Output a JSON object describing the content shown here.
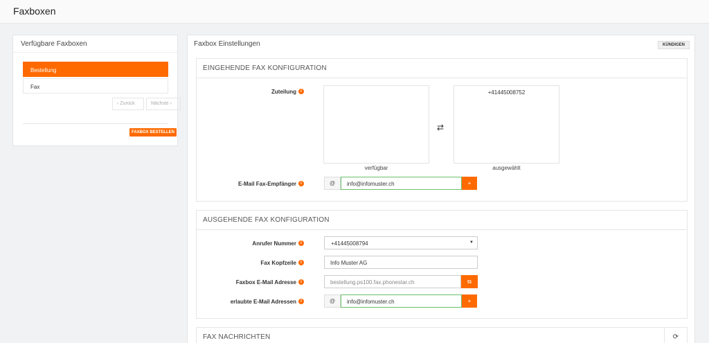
{
  "header": {
    "title": "Faxboxen"
  },
  "left": {
    "title": "Verfügbare Faxboxen",
    "items": [
      {
        "label": "Bestellung"
      },
      {
        "label": "Fax"
      }
    ],
    "prev_label": "‹ Zurück",
    "next_label": "Nächste ›",
    "order_button": "FAXBOX BESTELLEN"
  },
  "right": {
    "title": "Faxbox Einstellungen",
    "cancel_button": "KÜNDIGEN",
    "incoming": {
      "title": "EINGEHENDE FAX KONFIGURATION",
      "assignment_label": "Zuteilung",
      "available_caption": "verfügbar",
      "selected_caption": "ausgewählt",
      "selected_items": [
        "+41445008752"
      ],
      "swap_icon": "⇄",
      "email_label": "E-Mail Fax-Empfänger",
      "email_value": "info@infomuster.ch",
      "at_icon": "@",
      "plus": "+"
    },
    "outgoing": {
      "title": "AUSGEHENDE FAX KONFIGURATION",
      "caller_label": "Anrufer Nummer",
      "caller_value": "+41445008794",
      "header_label": "Fax Kopfzeile",
      "header_value": "Info Muster AG",
      "faxbox_email_label": "Faxbox E-Mail Adresse",
      "faxbox_email_value": "bestellung.ps100.fax.phonestar.ch",
      "allowed_label": "erlaubte E-Mail Adressen",
      "allowed_value": "info@infomuster.ch",
      "at_icon": "@",
      "plus": "+"
    },
    "messages": {
      "title": "FAX NACHRICHTEN",
      "refresh_icon": "⟳"
    }
  },
  "colors": {
    "accent": "#ff6a00",
    "valid_border": "#6bbf6b"
  }
}
